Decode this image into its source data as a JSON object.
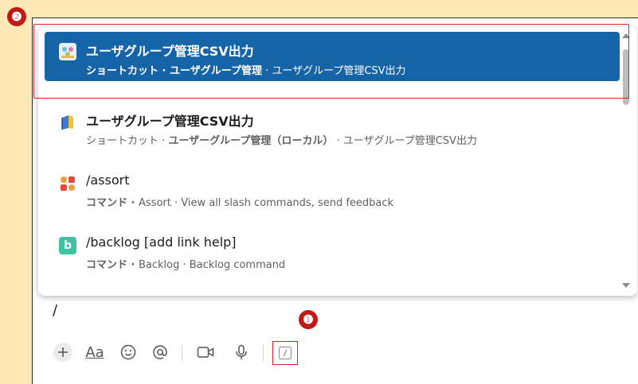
{
  "callouts": {
    "one": "❶",
    "two": "❷"
  },
  "items": [
    {
      "title": "ユーザグループ管理CSV出力",
      "sub_prefix": "ショートカット · ",
      "sub_bold": "ユーザグループ管理",
      "sub_suffix": " · ユーザグループ管理CSV出力",
      "icon": "usergroup-app-icon",
      "selected": true
    },
    {
      "title": "ユーザグループ管理CSV出力",
      "sub_prefix": "ショートカット · ",
      "sub_bold": "ユーザーグループ管理（ローカル）",
      "sub_suffix": " · ユーザグループ管理CSV出力",
      "icon": "book-icon",
      "selected": false
    },
    {
      "title": "/assort",
      "sub_prefix": "コマンド · ",
      "sub_bold": "Assort",
      "sub_suffix": " · View all slash commands, send feedback",
      "icon": "assort-app-icon",
      "selected": false
    },
    {
      "title": "/backlog [add link help]",
      "sub_prefix": "コマンド · ",
      "sub_bold": "Backlog",
      "sub_suffix": " · Backlog command",
      "icon": "backlog-app-icon",
      "icon_letter": "b",
      "selected": false
    }
  ],
  "composer": {
    "text": "/"
  },
  "toolbar": {
    "format_label": "Aa"
  },
  "colors": {
    "selected_bg": "#1664a8",
    "callout": "#c01a16",
    "highlight": "#d8232a",
    "background": "#fde9b4"
  }
}
